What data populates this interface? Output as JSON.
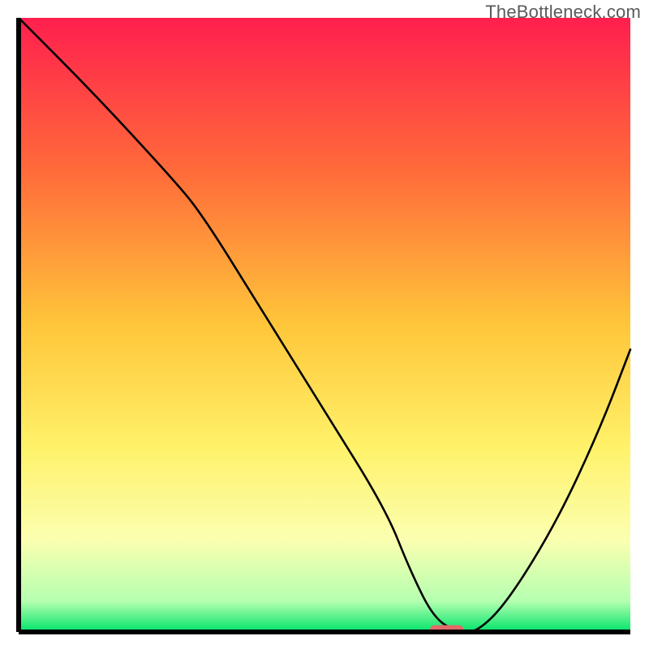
{
  "watermark": "TheBottleneck.com",
  "chart_data": {
    "type": "line",
    "title": "",
    "xlabel": "",
    "ylabel": "",
    "xlim": [
      0,
      100
    ],
    "ylim": [
      0,
      100
    ],
    "grid": false,
    "legend": false,
    "background_gradient": {
      "stops": [
        {
          "pos": 0,
          "color": "#ff1f4e"
        },
        {
          "pos": 25,
          "color": "#ff6b3a"
        },
        {
          "pos": 50,
          "color": "#ffc63a"
        },
        {
          "pos": 70,
          "color": "#fff26a"
        },
        {
          "pos": 85,
          "color": "#fbffb0"
        },
        {
          "pos": 95,
          "color": "#b5ffb0"
        },
        {
          "pos": 100,
          "color": "#00e46a"
        }
      ]
    },
    "marker": {
      "x": 70,
      "y": 0,
      "width_pct": 5.5,
      "height_pct": 1.5,
      "color": "#e36a6a",
      "shape": "rounded-rect"
    },
    "series": [
      {
        "name": "bottleneck-curve",
        "x": [
          0,
          12,
          25,
          30,
          40,
          50,
          60,
          64,
          68,
          72,
          75,
          80,
          88,
          95,
          100
        ],
        "values": [
          100,
          88,
          74,
          68,
          52,
          36,
          20,
          10,
          2,
          0,
          0,
          5,
          18,
          33,
          46
        ]
      }
    ]
  }
}
